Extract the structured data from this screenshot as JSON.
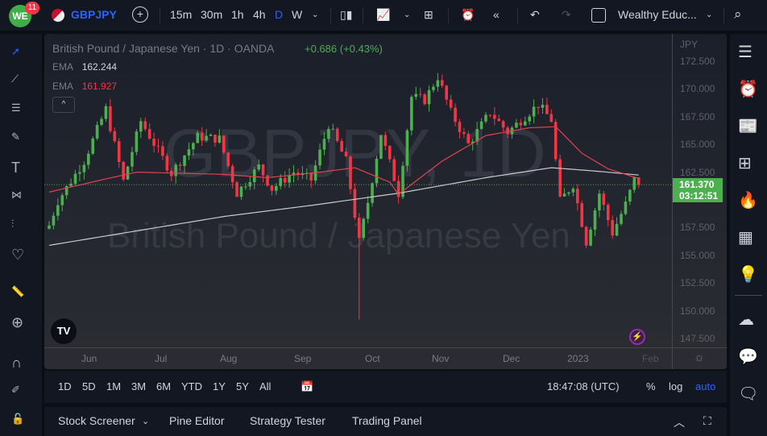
{
  "topbar": {
    "badge": "11",
    "logo": "WE",
    "symbol": "GBPJPY",
    "intervals": [
      "15m",
      "30m",
      "1h",
      "4h",
      "D",
      "W"
    ],
    "active_interval": "D",
    "layout_name": "Wealthy Educ..."
  },
  "legend": {
    "title": "British Pound / Japanese Yen · 1D · OANDA",
    "change": "+0.686 (+0.43%)",
    "ema1_label": "EMA",
    "ema1_value": "162.244",
    "ema2_label": "EMA",
    "ema2_value": "161.927"
  },
  "watermark": {
    "line1": "GBPJPY, 1D",
    "line2": "British Pound / Japanese Yen"
  },
  "axis": {
    "currency": "JPY",
    "ticks": [
      "172.500",
      "170.000",
      "167.500",
      "165.000",
      "162.500",
      "157.500",
      "155.000",
      "152.500",
      "150.000",
      "147.500"
    ],
    "tick_values": [
      172.5,
      170,
      167.5,
      165,
      162.5,
      157.5,
      155,
      152.5,
      150,
      147.5
    ],
    "last_price": "161.370",
    "countdown": "03:12:51",
    "last_value": 161.37
  },
  "months": [
    "Jun",
    "Jul",
    "Aug",
    "Sep",
    "Oct",
    "Nov",
    "Dec",
    "2023",
    "Feb"
  ],
  "colors": {
    "up": "#4caf50",
    "down": "#f23645",
    "ema_slow": "#c9cbd1",
    "ema_fast": "#e0424f",
    "accent": "#2962ff"
  },
  "chart_data": {
    "type": "candlestick",
    "ylim": [
      146.5,
      174.5
    ],
    "candle_count": 136,
    "close_path": [
      [
        0,
        157.7
      ],
      [
        2,
        159.9
      ],
      [
        8,
        163.5
      ],
      [
        13,
        168.2
      ],
      [
        17,
        161.7
      ],
      [
        21,
        167.1
      ],
      [
        28,
        162.4
      ],
      [
        34,
        165.7
      ],
      [
        39,
        165.5
      ],
      [
        43,
        160.6
      ],
      [
        48,
        163
      ],
      [
        51,
        161
      ],
      [
        56,
        162.5
      ],
      [
        60,
        161.8
      ],
      [
        64,
        166.8
      ],
      [
        68,
        163.5
      ],
      [
        71,
        156.2
      ],
      [
        73,
        159.8
      ],
      [
        76,
        166
      ],
      [
        80,
        160.6
      ],
      [
        83,
        169.3
      ],
      [
        86,
        169
      ],
      [
        89,
        171.1
      ],
      [
        92,
        167.9
      ],
      [
        96,
        165
      ],
      [
        101,
        167.9
      ],
      [
        105,
        166.1
      ],
      [
        112,
        168.6
      ],
      [
        115,
        167.2
      ],
      [
        117,
        159.9
      ],
      [
        120,
        161.4
      ],
      [
        123,
        156.2
      ],
      [
        126,
        160.6
      ],
      [
        129,
        157
      ],
      [
        132,
        159.6
      ],
      [
        134,
        161.8
      ],
      [
        135,
        161.37
      ]
    ],
    "ema_slow": [
      [
        0,
        155.9
      ],
      [
        20,
        157.2
      ],
      [
        40,
        158.5
      ],
      [
        60,
        159.5
      ],
      [
        80,
        160.6
      ],
      [
        100,
        162
      ],
      [
        115,
        162.9
      ],
      [
        125,
        162.6
      ],
      [
        135,
        162.24
      ]
    ],
    "ema_fast": [
      [
        0,
        160.7
      ],
      [
        12,
        161.8
      ],
      [
        20,
        162.5
      ],
      [
        40,
        162.3
      ],
      [
        50,
        162
      ],
      [
        62,
        162.5
      ],
      [
        70,
        162.9
      ],
      [
        78,
        161.6
      ],
      [
        80,
        160.5
      ],
      [
        90,
        163.5
      ],
      [
        100,
        165.8
      ],
      [
        110,
        166.5
      ],
      [
        116,
        166.6
      ],
      [
        122,
        164.2
      ],
      [
        128,
        162.8
      ],
      [
        135,
        161.93
      ]
    ]
  },
  "bottom_tf": {
    "ranges": [
      "1D",
      "5D",
      "1M",
      "3M",
      "6M",
      "YTD",
      "1Y",
      "5Y",
      "All"
    ],
    "time": "18:47:08 (UTC)",
    "pct": "%",
    "log": "log",
    "auto": "auto"
  },
  "bottom_panel": {
    "tabs": [
      "Stock Screener",
      "Pine Editor",
      "Strategy Tester",
      "Trading Panel"
    ]
  }
}
